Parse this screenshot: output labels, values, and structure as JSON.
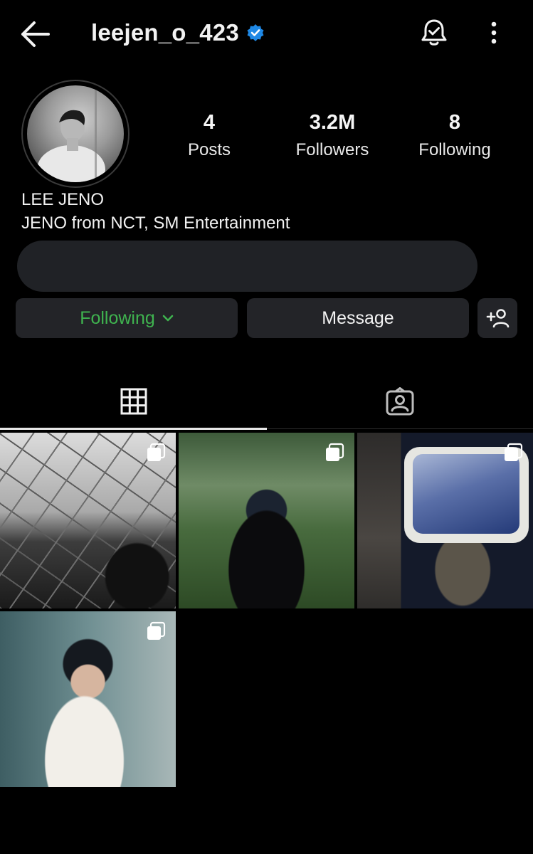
{
  "header": {
    "username": "leejen_o_423",
    "verified": true,
    "icons": {
      "back": "arrow-left-icon",
      "notifications": "bell-check-icon",
      "more": "more-vertical-icon"
    }
  },
  "profile": {
    "avatar": "profile-photo",
    "stats": {
      "posts": {
        "value": "4",
        "label": "Posts"
      },
      "followers": {
        "value": "3.2M",
        "label": "Followers"
      },
      "following": {
        "value": "8",
        "label": "Following"
      }
    },
    "display_name": "LEE JENO",
    "bio": "JENO from NCT, SM Entertainment"
  },
  "actions": {
    "following_label": "Following",
    "message_label": "Message",
    "add_user_icon": "add-person-icon"
  },
  "colors": {
    "background": "#000000",
    "button": "#232428",
    "following_green": "#3fb34f",
    "verified_blue": "#1e88e5"
  },
  "tabs": [
    {
      "name": "posts-grid",
      "icon": "grid-icon",
      "active": true
    },
    {
      "name": "tagged",
      "icon": "tagged-person-icon",
      "active": false
    }
  ],
  "posts": [
    {
      "id": 1,
      "type": "carousel"
    },
    {
      "id": 2,
      "type": "carousel"
    },
    {
      "id": 3,
      "type": "carousel"
    },
    {
      "id": 4,
      "type": "carousel"
    }
  ]
}
